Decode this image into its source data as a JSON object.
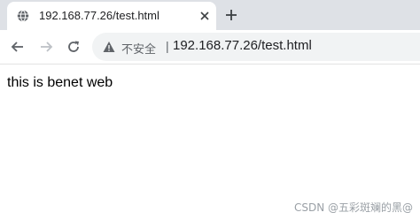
{
  "tab": {
    "title": "192.168.77.26/test.html",
    "favicon": "globe-icon",
    "close_icon": "close-icon"
  },
  "new_tab_icon": "plus-icon",
  "toolbar": {
    "back_icon": "back-arrow-icon",
    "forward_icon": "forward-arrow-icon",
    "reload_icon": "reload-icon"
  },
  "omnibox": {
    "security_icon": "warning-triangle-icon",
    "security_label": "不安全",
    "separator": "|",
    "url": "192.168.77.26/test.html"
  },
  "page": {
    "text": "this is benet web"
  },
  "watermark": "CSDN @五彩斑斓的黑@",
  "colors": {
    "tabstrip": "#dee1e6",
    "omnibox": "#f1f3f4",
    "icon": "#5f6368"
  }
}
